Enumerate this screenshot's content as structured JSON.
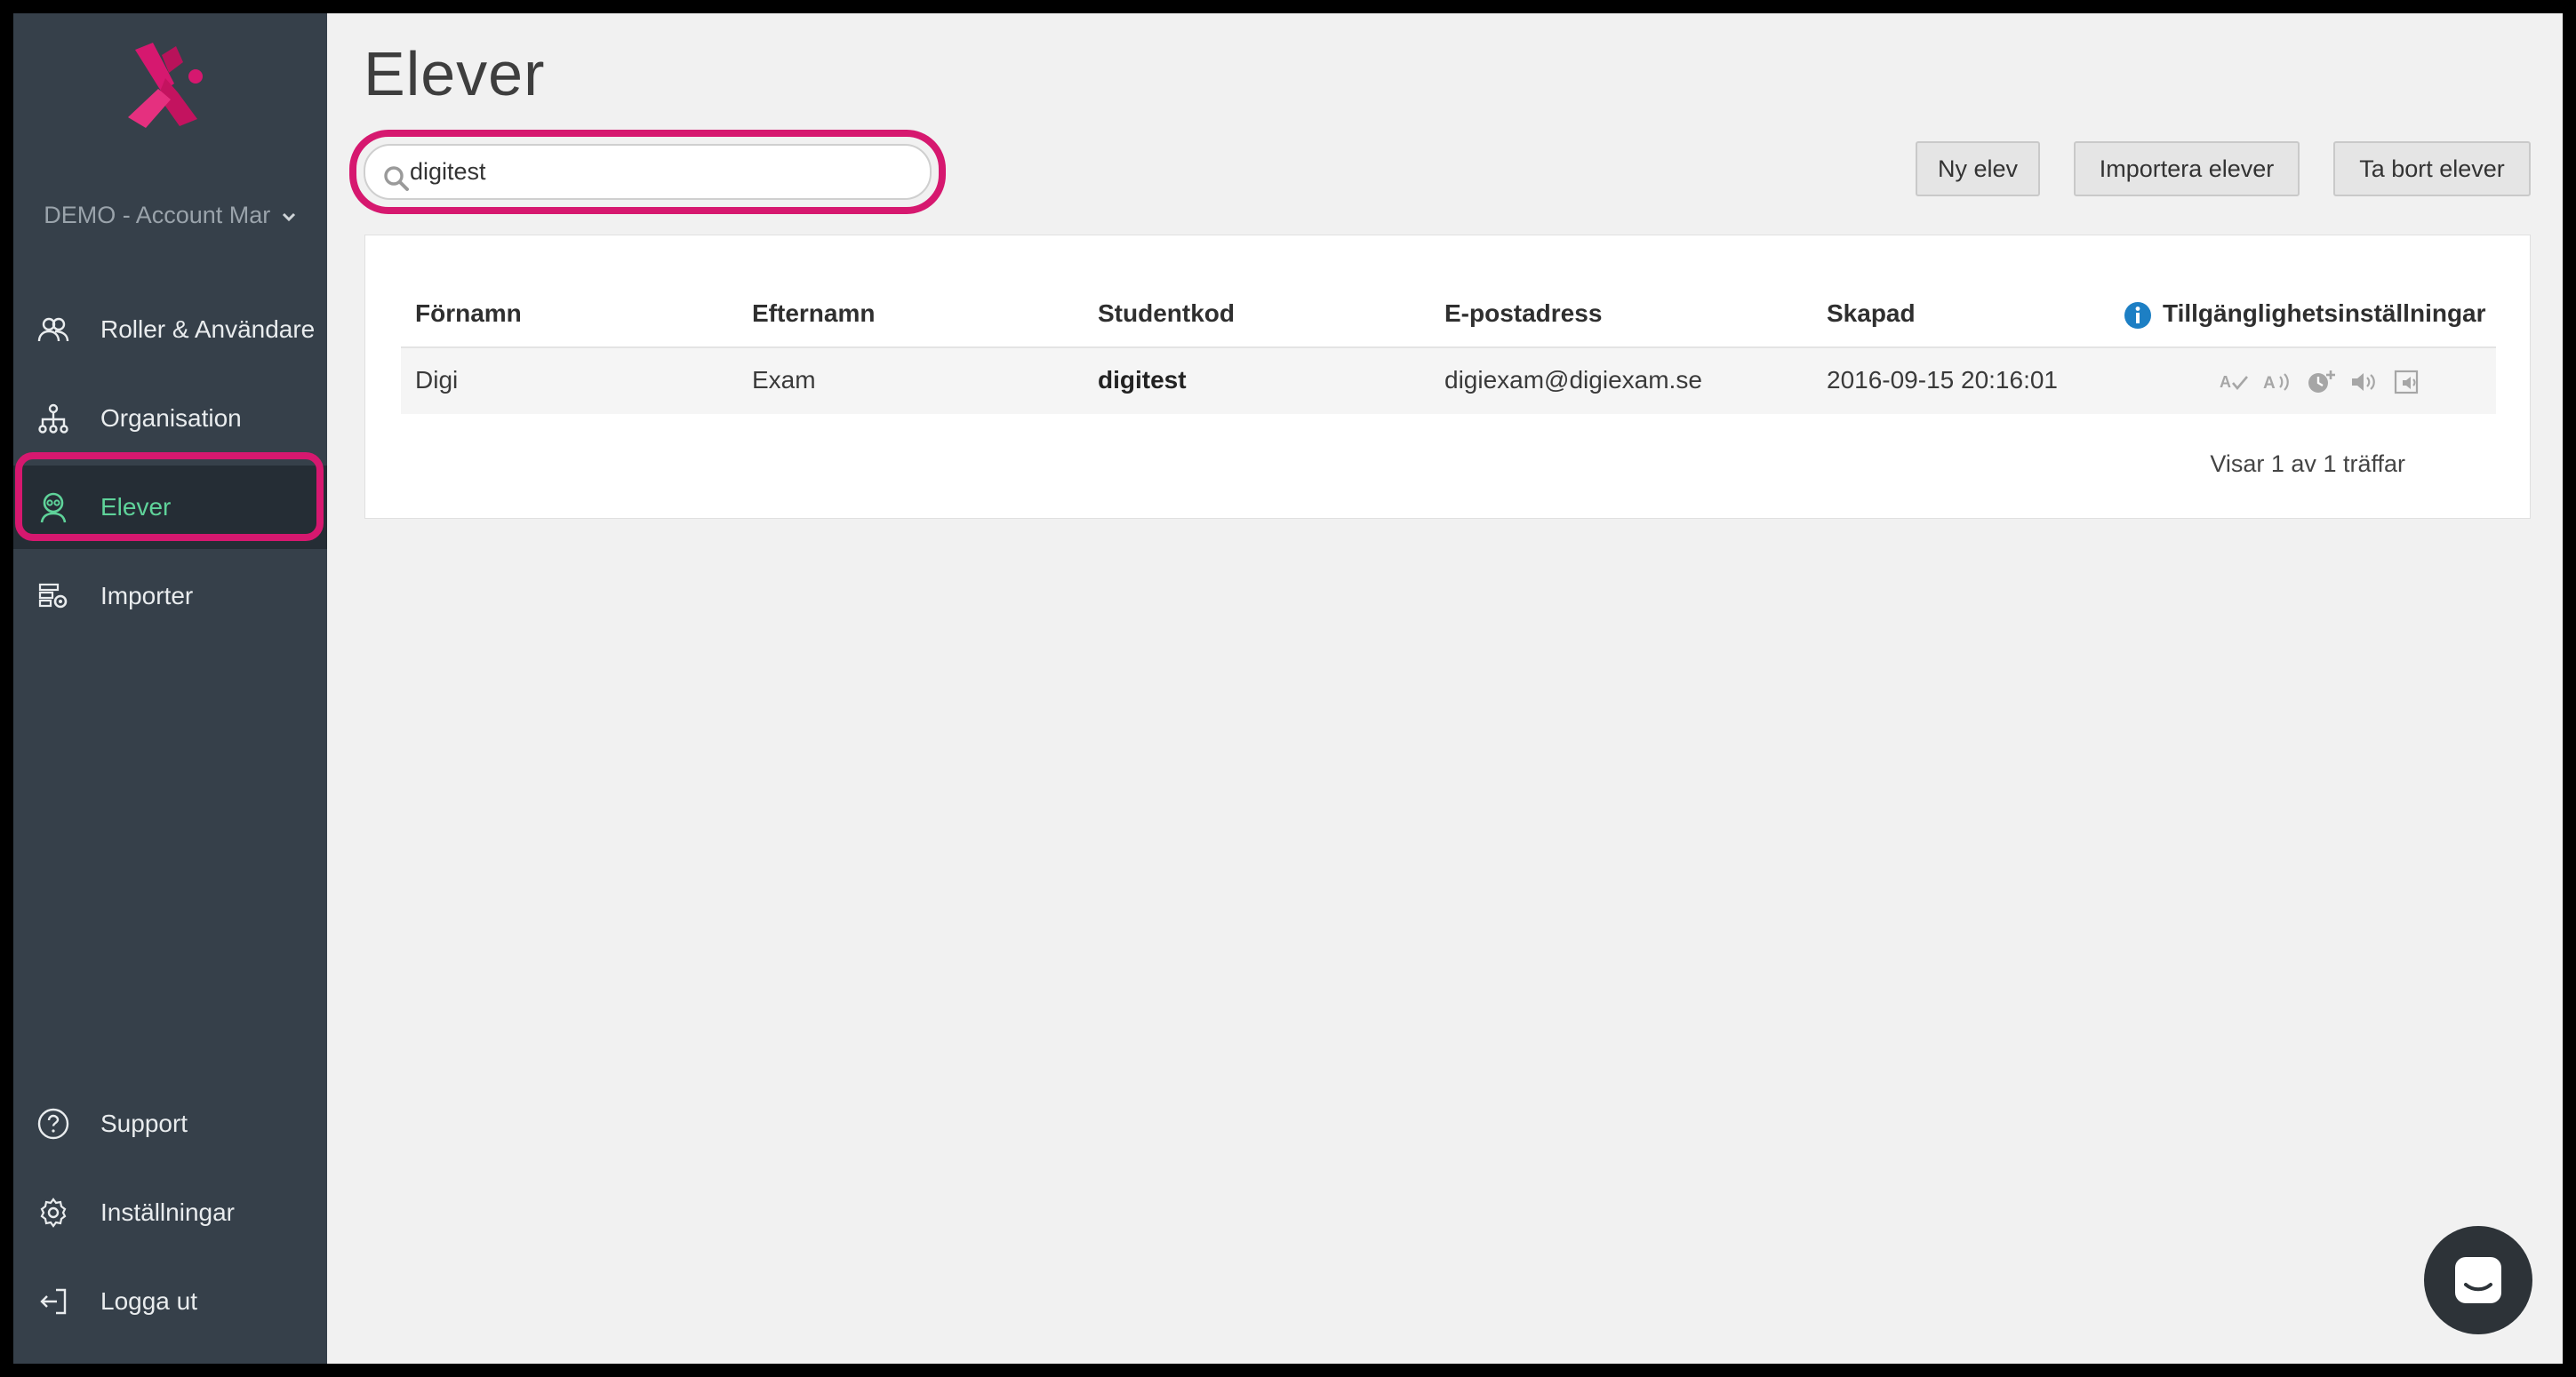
{
  "account": {
    "name": "DEMO - Account Mar"
  },
  "sidebar": {
    "items": [
      {
        "label": "Roller & Användare",
        "icon": "users-icon"
      },
      {
        "label": "Organisation",
        "icon": "org-chart-icon"
      },
      {
        "label": "Elever",
        "icon": "student-icon",
        "active": true
      },
      {
        "label": "Importer",
        "icon": "import-icon"
      }
    ],
    "bottom": [
      {
        "label": "Support",
        "icon": "help-icon"
      },
      {
        "label": "Inställningar",
        "icon": "gear-icon"
      },
      {
        "label": "Logga ut",
        "icon": "logout-icon"
      }
    ]
  },
  "page": {
    "title": "Elever"
  },
  "search": {
    "value": "digitest",
    "placeholder": ""
  },
  "toolbar": {
    "new_label": "Ny elev",
    "import_label": "Importera elever",
    "delete_label": "Ta bort elever"
  },
  "table": {
    "headers": [
      "Förnamn",
      "Efternamn",
      "Studentkod",
      "E-postadress",
      "Skapad",
      "Tillgänglighetsinställningar"
    ],
    "rows": [
      {
        "first": "Digi",
        "last": "Exam",
        "code": "digitest",
        "email": "digiexam@digiexam.se",
        "created": "2016-09-15 20:16:01"
      }
    ],
    "accessibility_icons": [
      "spellcheck-icon",
      "text-to-speech-icon",
      "extra-time-icon",
      "audio-icon",
      "screen-reader-icon"
    ],
    "pager": "Visar 1 av 1 träffar"
  },
  "colors": {
    "brand": "#d6186f",
    "sidebar": "#36404a",
    "active_text": "#5fd39a",
    "info": "#1d7fc4"
  }
}
